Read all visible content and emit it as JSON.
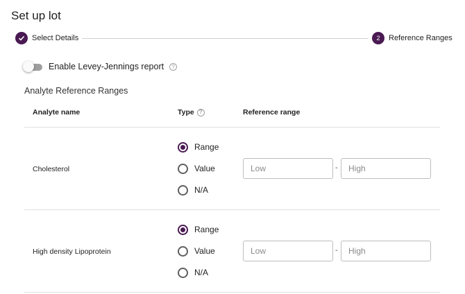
{
  "page": {
    "title": "Set up lot"
  },
  "stepper": {
    "steps": [
      {
        "label": "Select Details",
        "state": "complete",
        "icon": "check-icon"
      },
      {
        "number": "2",
        "label": "Reference Ranges",
        "state": "active"
      }
    ]
  },
  "levey_jennings": {
    "label": "Enable Levey-Jennings report",
    "enabled": false,
    "help_icon": "?"
  },
  "section": {
    "title": "Analyte Reference Ranges"
  },
  "table": {
    "headers": {
      "analyte": "Analyte name",
      "type": "Type",
      "range": "Reference range"
    },
    "type_help_icon": "?",
    "rows": [
      {
        "analyte": "Cholesterol",
        "options": [
          "Range",
          "Value",
          "N/A"
        ],
        "selected": "Range",
        "low_placeholder": "Low",
        "high_placeholder": "High",
        "separator": "-"
      },
      {
        "analyte": "High density Lipoprotein",
        "options": [
          "Range",
          "Value",
          "N/A"
        ],
        "selected": "Range",
        "low_placeholder": "Low",
        "high_placeholder": "High",
        "separator": "-"
      }
    ]
  },
  "colors": {
    "accent": "#4a1a52",
    "divider": "#e0e0e0",
    "toggle_off": "#9e9e9e"
  }
}
